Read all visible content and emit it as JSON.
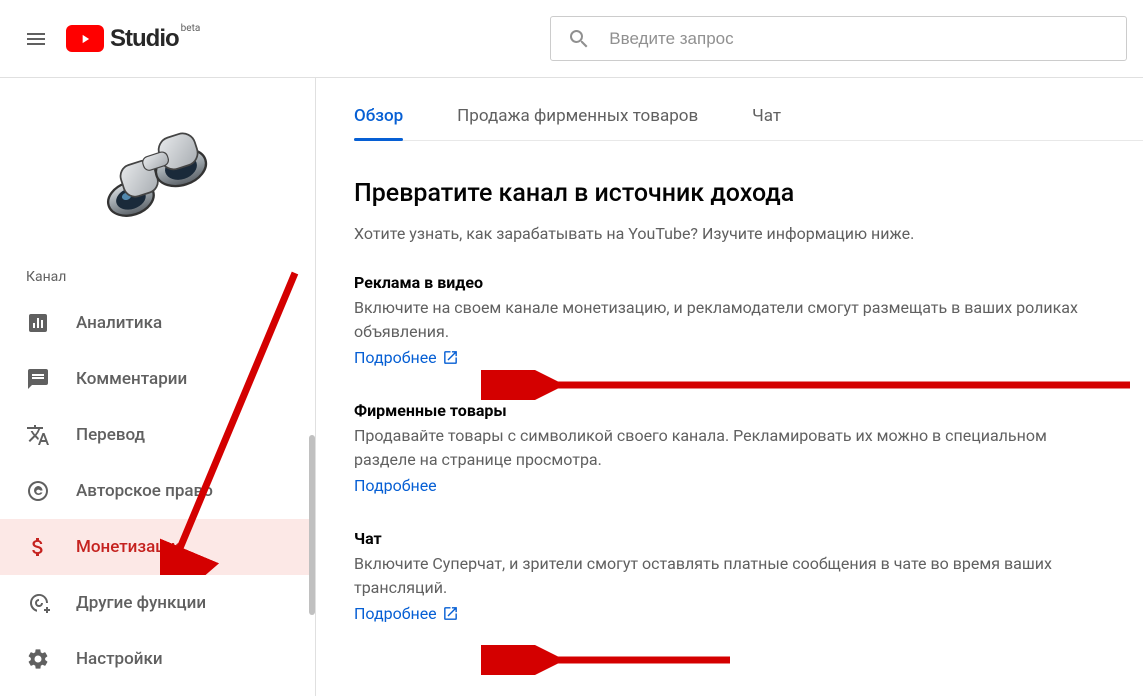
{
  "header": {
    "logo_text": "Studio",
    "logo_sup": "beta",
    "search_placeholder": "Введите запрос"
  },
  "sidebar": {
    "channel_label": "Канал",
    "items": [
      {
        "label": "Аналитика",
        "icon": "analytics",
        "active": false
      },
      {
        "label": "Комментарии",
        "icon": "comments",
        "active": false
      },
      {
        "label": "Перевод",
        "icon": "translate",
        "active": false
      },
      {
        "label": "Авторское право",
        "icon": "copyright",
        "active": false
      },
      {
        "label": "Монетизация",
        "icon": "dollar",
        "active": true
      },
      {
        "label": "Другие функции",
        "icon": "add-tool",
        "active": false
      },
      {
        "label": "Настройки",
        "icon": "gear",
        "active": false
      }
    ]
  },
  "tabs": [
    {
      "label": "Обзор",
      "active": true
    },
    {
      "label": "Продажа фирменных товаров",
      "active": false
    },
    {
      "label": "Чат",
      "active": false
    }
  ],
  "main": {
    "title": "Превратите канал в источник дохода",
    "lead": "Хотите узнать, как зарабатывать на YouTube? Изучите информацию ниже.",
    "sections": [
      {
        "heading": "Реклама в видео",
        "body": "Включите на своем канале монетизацию, и рекламодатели смогут размещать в ваших роликах объявления.",
        "link_label": "Подробнее",
        "external": true
      },
      {
        "heading": "Фирменные товары",
        "body": "Продавайте товары с символикой своего канала. Рекламировать их можно в специальном разделе на странице просмотра.",
        "link_label": "Подробнее",
        "external": false
      },
      {
        "heading": "Чат",
        "body": "Включите Суперчат, и зрители смогут оставлять платные сообщения в чате во время ваших трансляций.",
        "link_label": "Подробнее",
        "external": true
      }
    ]
  }
}
